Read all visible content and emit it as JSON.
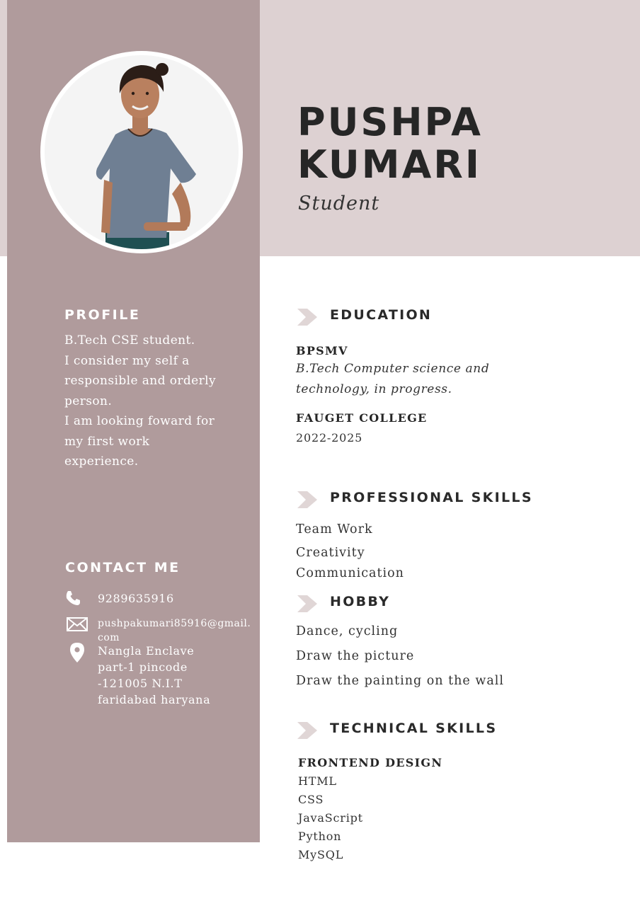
{
  "header": {
    "name_line1": "PUSHPA",
    "name_line2": "KUMARI",
    "role": "Student"
  },
  "colors": {
    "sidebar": "#b09b9c",
    "top_band": "#ddd1d2",
    "chevron": "#e0d6d6"
  },
  "profile": {
    "heading": "PROFILE",
    "lines": [
      "B.Tech CSE student.",
      "I consider my self a",
      "responsible and orderly",
      "person.",
      "I am looking foward for",
      "my first work",
      "experience."
    ]
  },
  "contact": {
    "heading": "CONTACT ME",
    "phone": "9289635916",
    "email_line1": "pushpakumari85916@gmail.",
    "email_line2": "com",
    "address_lines": [
      "Nangla Enclave",
      "part-1 pincode",
      "-121005 N.I.T",
      "faridabad haryana"
    ],
    "icons": [
      "phone-icon",
      "mail-icon",
      "location-pin-icon"
    ]
  },
  "education": {
    "heading": "EDUCATION",
    "school1": "BPSMV",
    "school1_detail_line1": "B.Tech Computer science and",
    "school1_detail_line2": "technology, in progress.",
    "school2": "FAUGET COLLEGE",
    "school2_years": "2022-2025"
  },
  "professional_skills": {
    "heading": "PROFESSIONAL SKILLS",
    "items": [
      "Team Work",
      "Creativity",
      "Communication"
    ]
  },
  "hobby": {
    "heading": "HOBBY",
    "items": [
      "Dance, cycling",
      "Draw the picture",
      "Draw the painting on the wall"
    ]
  },
  "technical_skills": {
    "heading": "TECHNICAL SKILLS",
    "subheading": "FRONTEND DESIGN",
    "items": [
      "HTML",
      "CSS",
      "JavaScript",
      "Python",
      "MySQL"
    ]
  }
}
